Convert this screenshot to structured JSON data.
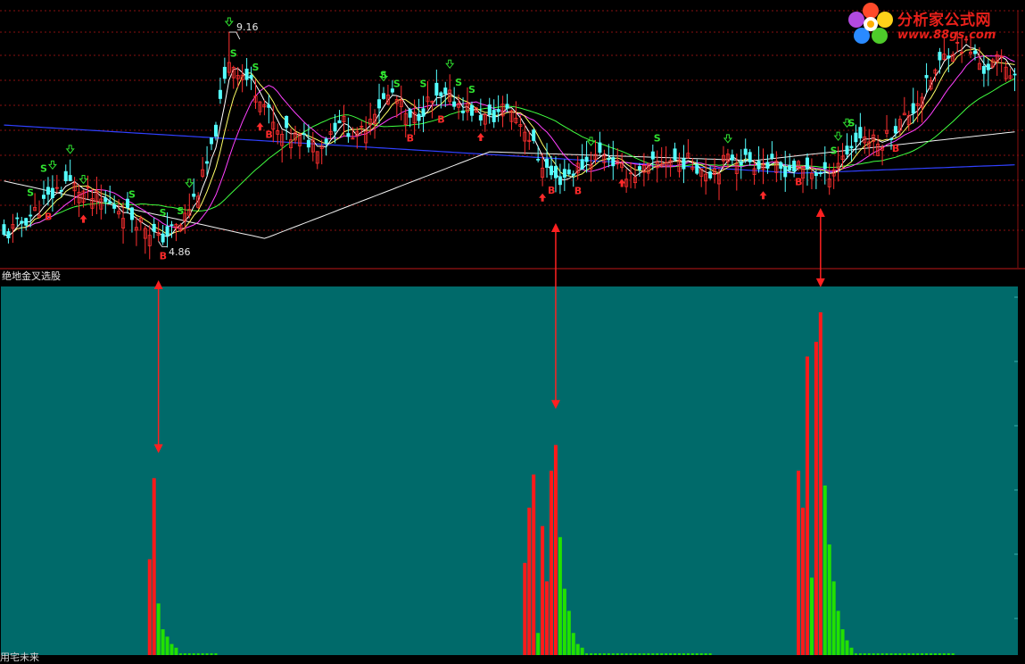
{
  "logo": {
    "brand": "分析家公式网",
    "url": "www.88gs.com"
  },
  "indicator_title": "绝地金叉选股",
  "footer_text": "用宅未来",
  "price_panel": {
    "high_label": "9.16",
    "low_label": "4.86",
    "colors": {
      "up": "#ff3030",
      "down": "#54ffff",
      "ma5": "#ffffff",
      "ma10": "#ffff66",
      "ma20": "#ff40ff",
      "ma60": "#40ff40",
      "ma120": "#f0f0f0",
      "ma250": "#3040ff"
    }
  },
  "chart_data": [
    {
      "type": "line",
      "description": "candlestick price chart with moving averages",
      "ylim": [
        4.5,
        9.6
      ],
      "x_range": [
        0,
        230
      ],
      "annotations": [
        {
          "text": "9.16",
          "x": 51,
          "y": 9.16
        },
        {
          "text": "4.86",
          "x": 35,
          "y": 4.86
        }
      ],
      "signals": {
        "S": [
          6,
          9,
          29,
          36,
          40,
          52,
          57,
          86,
          89,
          95,
          103,
          106,
          148,
          188,
          192
        ],
        "B": [
          10,
          36,
          60,
          92,
          99,
          124,
          130,
          180,
          202
        ]
      },
      "up_arrows": [
        18,
        58,
        108,
        122,
        140,
        172
      ],
      "down_arrows": [
        11,
        15,
        18,
        42,
        51,
        86,
        101,
        133,
        164,
        189,
        191
      ]
    },
    {
      "type": "bar",
      "description": "indicator histogram (red / green bars)",
      "ylim": [
        0,
        100
      ],
      "series": [
        {
          "color": "#ff1a1a",
          "values": [
            {
              "x": 33,
              "v": 26
            },
            {
              "x": 34,
              "v": 48
            },
            {
              "x": 118,
              "v": 25
            },
            {
              "x": 119,
              "v": 40
            },
            {
              "x": 120,
              "v": 49
            },
            {
              "x": 122,
              "v": 35
            },
            {
              "x": 123,
              "v": 20
            },
            {
              "x": 124,
              "v": 50
            },
            {
              "x": 125,
              "v": 57
            },
            {
              "x": 180,
              "v": 50
            },
            {
              "x": 181,
              "v": 40
            },
            {
              "x": 182,
              "v": 81
            },
            {
              "x": 184,
              "v": 85
            },
            {
              "x": 185,
              "v": 93
            }
          ]
        },
        {
          "color": "#22e000",
          "values": [
            {
              "x": 35,
              "v": 14
            },
            {
              "x": 36,
              "v": 7
            },
            {
              "x": 37,
              "v": 5
            },
            {
              "x": 38,
              "v": 3
            },
            {
              "x": 39,
              "v": 2
            },
            {
              "x": 121,
              "v": 6
            },
            {
              "x": 126,
              "v": 32
            },
            {
              "x": 127,
              "v": 18
            },
            {
              "x": 128,
              "v": 12
            },
            {
              "x": 129,
              "v": 6
            },
            {
              "x": 130,
              "v": 3
            },
            {
              "x": 131,
              "v": 2
            },
            {
              "x": 183,
              "v": 21
            },
            {
              "x": 186,
              "v": 46
            },
            {
              "x": 187,
              "v": 30
            },
            {
              "x": 188,
              "v": 20
            },
            {
              "x": 189,
              "v": 12
            },
            {
              "x": 190,
              "v": 7
            },
            {
              "x": 191,
              "v": 4
            },
            {
              "x": 192,
              "v": 2
            }
          ]
        }
      ],
      "pointers": [
        {
          "x": 35,
          "from": 99,
          "to": 48
        },
        {
          "x": 125,
          "from": 125,
          "to": 60
        },
        {
          "x": 185,
          "from": 115,
          "to": 93
        }
      ]
    }
  ]
}
